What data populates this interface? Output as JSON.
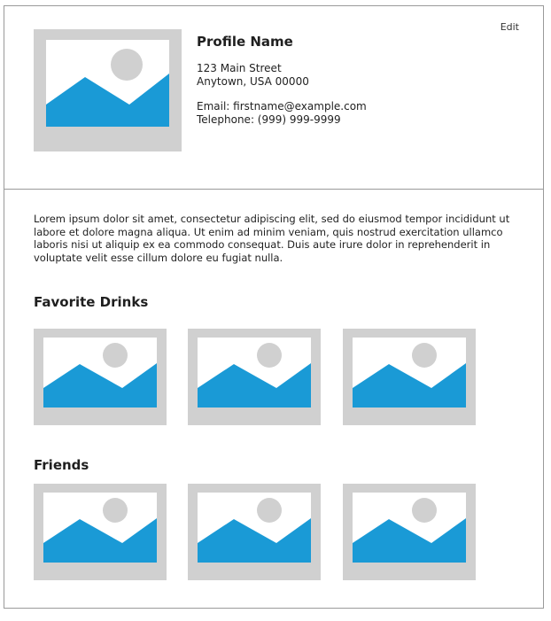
{
  "header": {
    "edit_label": "Edit",
    "profile_name": "Profile Name",
    "address_line1": "123 Main Street",
    "address_line2": "Anytown, USA 00000",
    "email": "Email: firstname@example.com",
    "telephone": "Telephone: (999) 999-9999"
  },
  "bio": "Lorem ipsum dolor sit amet, consectetur adipiscing elit, sed do eiusmod tempor incididunt ut labore et dolore magna aliqua. Ut enim ad minim veniam, quis nostrud exercitation ullamco laboris nisi ut aliquip ex ea commodo consequat. Duis aute irure dolor in reprehenderit in voluptate velit esse cillum dolore eu fugiat nulla.",
  "sections": {
    "drinks_title": "Favorite Drinks",
    "friends_title": "Friends"
  },
  "icons": {
    "image_placeholder": "image-placeholder-icon"
  },
  "colors": {
    "placeholder_frame": "#d0d0d0",
    "placeholder_sky": "#ffffff",
    "placeholder_mountain": "#1a9ad6",
    "placeholder_sun": "#d0d0d0",
    "divider": "#9a9a9a"
  }
}
